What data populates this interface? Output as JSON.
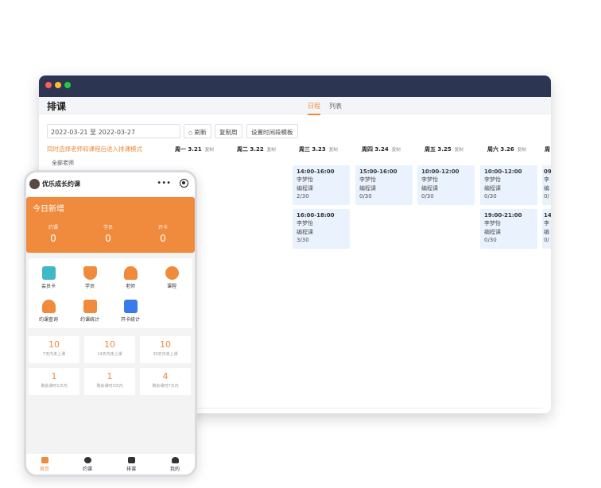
{
  "desktop": {
    "title": "排课",
    "tabs": [
      {
        "label": "日程",
        "active": true
      },
      {
        "label": "列表",
        "active": false
      }
    ],
    "date_range": "2022-03-21 至 2022-03-27",
    "buttons": {
      "refresh": "刷新",
      "copy_week": "复制周",
      "set_time_template": "设置时间段模板"
    },
    "hint": "同时选择老师和课程后进入排课模式",
    "teacher_select": "全部老师",
    "days": [
      {
        "name": "周一 3.21",
        "copy": "复制"
      },
      {
        "name": "周二 3.22",
        "copy": "复制"
      },
      {
        "name": "周三 3.23",
        "copy": "复制"
      },
      {
        "name": "周四 3.24",
        "copy": "复制"
      },
      {
        "name": "周五 3.25",
        "copy": "复制"
      },
      {
        "name": "周六 3.26",
        "copy": "复制"
      },
      {
        "name": "周日",
        "copy": ""
      }
    ],
    "cards": [
      {
        "time": "14:00-16:00",
        "teacher": "李梦怡",
        "course": "编程课",
        "count": "2/30"
      },
      {
        "time": "15:00-16:00",
        "teacher": "李梦怡",
        "course": "编程课",
        "count": "0/30"
      },
      {
        "time": "10:00-12:00",
        "teacher": "李梦怡",
        "course": "编程课",
        "count": "0/30"
      },
      {
        "time": "10:00-12:00",
        "teacher": "李梦怡",
        "course": "编程课",
        "count": "0/30"
      },
      {
        "time": "09",
        "teacher": "李",
        "course": "编",
        "count": "0/"
      },
      {
        "time": "16:00-18:00",
        "teacher": "李梦怡",
        "course": "编程课",
        "count": "3/30"
      },
      {
        "time": "19:00-21:00",
        "teacher": "李梦怡",
        "course": "编程课",
        "count": "0/30"
      },
      {
        "time": "14",
        "teacher": "李",
        "course": "编",
        "count": "0/"
      }
    ]
  },
  "phone": {
    "app_name": "优乐成长约课",
    "menu": "•••",
    "today": {
      "title": "今日新增",
      "stats": [
        {
          "label": "约课",
          "value": "0"
        },
        {
          "label": "学员",
          "value": "0"
        },
        {
          "label": "开卡",
          "value": "0"
        }
      ]
    },
    "icons": [
      {
        "label": "会员卡",
        "color": "#3fb8c8"
      },
      {
        "label": "学员",
        "color": "#f08a3c"
      },
      {
        "label": "老师",
        "color": "#f08a3c"
      },
      {
        "label": "课程",
        "color": "#f08a3c"
      },
      {
        "label": "约课查询",
        "color": "#f08a3c"
      },
      {
        "label": "约课统计",
        "color": "#f08a3c"
      },
      {
        "label": "开卡统计",
        "color": "#3b7be8"
      }
    ],
    "boxes": [
      {
        "num": "10",
        "label": "7天内未上课"
      },
      {
        "num": "10",
        "label": "14天内未上课"
      },
      {
        "num": "10",
        "label": "30天内未上课"
      },
      {
        "num": "1",
        "label": "剩余课时1次内"
      },
      {
        "num": "1",
        "label": "剩余课时3次内"
      },
      {
        "num": "4",
        "label": "剩余课时7次内"
      }
    ],
    "nav": [
      {
        "label": "首页",
        "active": true
      },
      {
        "label": "约课",
        "active": false
      },
      {
        "label": "排课",
        "active": false
      },
      {
        "label": "我的",
        "active": false
      }
    ]
  },
  "colors": {
    "accent": "#f08a3c",
    "titlebar": "#2c3552",
    "card_bg": "#eaf2fd"
  }
}
